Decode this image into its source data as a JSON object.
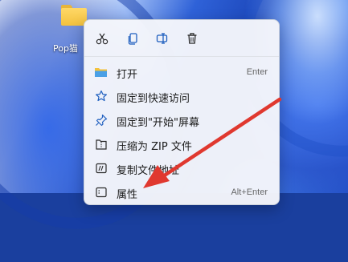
{
  "desktop": {
    "icon_label": "Pop猫"
  },
  "toolbar": {
    "cut_icon": "scissors-icon",
    "copy_icon": "copy-icon",
    "rename_icon": "rename-icon",
    "delete_icon": "trash-icon"
  },
  "menu": {
    "items": [
      {
        "label": "打开",
        "shortcut": "Enter",
        "icon": "folder-open-icon"
      },
      {
        "label": "固定到快速访问",
        "shortcut": "",
        "icon": "star-icon"
      },
      {
        "label": "固定到\"开始\"屏幕",
        "shortcut": "",
        "icon": "pin-icon"
      },
      {
        "label": "压缩为 ZIP 文件",
        "shortcut": "",
        "icon": "zip-icon"
      },
      {
        "label": "复制文件地址",
        "shortcut": "",
        "icon": "copy-path-icon"
      },
      {
        "label": "属性",
        "shortcut": "Alt+Enter",
        "icon": "properties-icon"
      }
    ]
  },
  "colors": {
    "accent": "#1f5fbf",
    "arrow": "#e0382f"
  }
}
